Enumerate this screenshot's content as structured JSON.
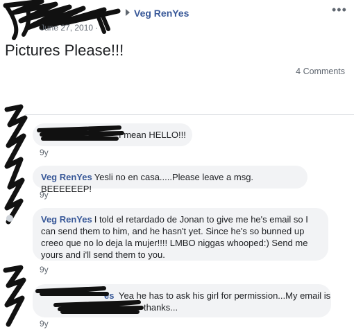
{
  "post": {
    "author": "Veg RenYes",
    "date": "June 27, 2010 ·",
    "more_icon": "more-horizontal-icon",
    "text": "Pictures Please!!!",
    "comments_count": "4 Comments"
  },
  "comments": [
    {
      "name": "",
      "text": "I mean HELLO!!!",
      "age": "9y"
    },
    {
      "name": "Veg RenYes",
      "text": "Yesli no en casa.....Please leave a msg. BEEEEEEP!",
      "age": "9y"
    },
    {
      "name": "Veg RenYes",
      "text": "I told el retardado de Jonan to give me he's email so I can send them to him, and he hasn't yet. Since he's so bunned up creeo que no lo deja la mujer!!!! LMBO niggas whooped:) Send me yours and i'll send them to you.",
      "age": "9y"
    },
    {
      "name": "es",
      "text": "Yea he has to ask his girl for permission...My email is",
      "text_tail": "thanks...",
      "age": "9y"
    }
  ],
  "colors": {
    "link": "#385898",
    "bubble": "#f2f3f5",
    "meta": "#606770"
  }
}
